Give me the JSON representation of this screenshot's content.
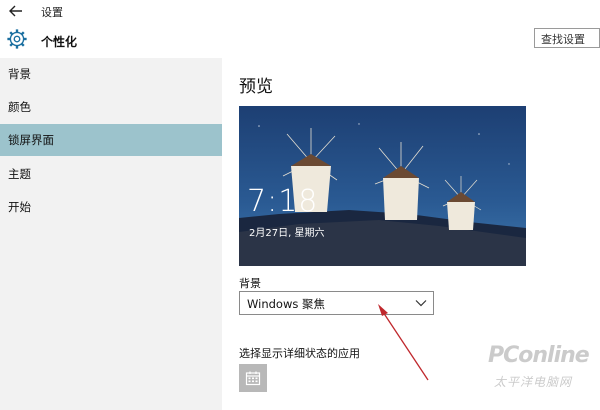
{
  "window": {
    "title": "设置",
    "back_icon": "back-arrow-icon"
  },
  "header": {
    "title": "个性化",
    "icon": "gear-icon",
    "search_placeholder": "查找设置"
  },
  "sidebar": {
    "items": [
      {
        "label": "背景",
        "active": false
      },
      {
        "label": "颜色",
        "active": false
      },
      {
        "label": "锁屏界面",
        "active": true
      },
      {
        "label": "主题",
        "active": false
      },
      {
        "label": "开始",
        "active": false
      }
    ],
    "active_color": "#9cc3cc"
  },
  "main": {
    "section_title": "预览",
    "preview": {
      "time": "7:18",
      "date": "2月27日, 星期六"
    },
    "background": {
      "label": "背景",
      "selected": "Windows 聚焦"
    },
    "detail_status": {
      "label": "选择显示详细状态的应用",
      "app_icon": "calendar-icon"
    }
  },
  "annotation": {
    "arrow_color": "#c0282d"
  },
  "watermark": {
    "main": "PConline",
    "sub": "太平洋电脑网"
  }
}
